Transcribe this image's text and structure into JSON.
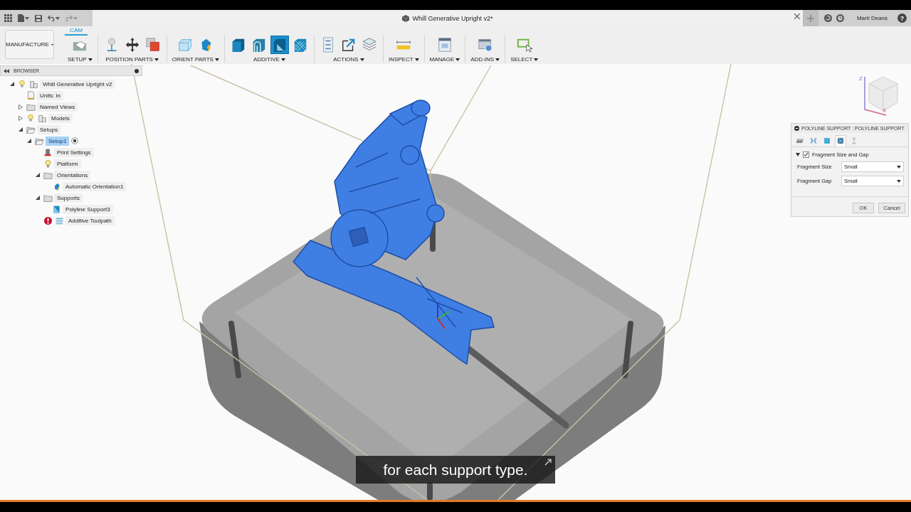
{
  "app_bar": {
    "document_title": "Whill Generative Upright v2*",
    "user": "Marti Deans",
    "help_label": "?"
  },
  "toolbar": {
    "workspace": "MANUFACTURE",
    "tabs": [
      {
        "label": "CAM",
        "selected": true
      }
    ],
    "groups": [
      {
        "label": "SETUP",
        "tools": [
          {
            "selected": false
          }
        ]
      },
      {
        "label": "POSITION PARTS",
        "tools": [
          {
            "selected": false
          },
          {
            "selected": false
          },
          {
            "selected": false
          }
        ]
      },
      {
        "label": "ORIENT PARTS",
        "tools": [
          {
            "selected": false
          },
          {
            "selected": false
          }
        ]
      },
      {
        "label": "ADDITIVE",
        "tools": [
          {
            "selected": false
          },
          {
            "selected": false
          },
          {
            "selected": true
          },
          {
            "selected": false
          }
        ]
      },
      {
        "label": "ACTIONS",
        "tools": [
          {
            "selected": false
          },
          {
            "selected": false
          },
          {
            "selected": false
          }
        ]
      },
      {
        "label": "INSPECT",
        "tools": [
          {
            "selected": false
          }
        ]
      },
      {
        "label": "MANAGE",
        "tools": [
          {
            "selected": false
          }
        ]
      },
      {
        "label": "ADD-INS",
        "tools": [
          {
            "selected": false
          }
        ]
      },
      {
        "label": "SELECT",
        "tools": [
          {
            "selected": false
          }
        ]
      }
    ]
  },
  "browser": {
    "title": "BROWSER",
    "tree": [
      {
        "label": "Whill Generative Upright v2",
        "kind": "component",
        "visible": true,
        "expanded": true,
        "selected": false,
        "children": [
          {
            "label": "Units: in",
            "kind": "units",
            "selected": false
          },
          {
            "label": "Named Views",
            "kind": "folder",
            "expanded": false,
            "selected": false
          },
          {
            "label": "Models",
            "kind": "component",
            "visible": true,
            "expanded": false,
            "selected": false
          },
          {
            "label": "Setups",
            "kind": "setup",
            "expanded": true,
            "selected": false,
            "children": [
              {
                "label": "Setup1",
                "kind": "setup",
                "expanded": true,
                "selected": true,
                "active": true,
                "children": [
                  {
                    "label": "Print Settings",
                    "kind": "settings",
                    "selected": false
                  },
                  {
                    "label": "Platform",
                    "kind": "platform",
                    "selected": false
                  },
                  {
                    "label": "Orientations",
                    "kind": "folder",
                    "expanded": true,
                    "selected": false,
                    "children": [
                      {
                        "label": "Automatic Orientation1",
                        "kind": "orientation",
                        "selected": false
                      }
                    ]
                  },
                  {
                    "label": "Supports",
                    "kind": "folder",
                    "expanded": true,
                    "selected": false,
                    "children": [
                      {
                        "label": "Polyline Support3",
                        "kind": "support",
                        "selected": false
                      }
                    ]
                  },
                  {
                    "label": "Additive Toolpath",
                    "kind": "toolpath",
                    "error": true,
                    "selected": false
                  }
                ]
              }
            ]
          }
        ]
      }
    ]
  },
  "viewcube": {
    "axes": [
      "Z",
      "X"
    ]
  },
  "dialog": {
    "title": "POLYLINE SUPPORT : POLYLINE SUPPORT",
    "tabs": [
      {
        "selected": false
      },
      {
        "selected": false
      },
      {
        "selected": false
      },
      {
        "selected": true
      },
      {
        "selected": false
      }
    ],
    "section": {
      "label": "Fragment Size and Gap",
      "expanded": true,
      "checked": true
    },
    "fields": [
      {
        "label": "Fragment Size",
        "value": "Small"
      },
      {
        "label": "Fragment Gap",
        "value": "Small"
      }
    ],
    "buttons": [
      "OK",
      "Cancel"
    ]
  },
  "caption": "for each support type."
}
